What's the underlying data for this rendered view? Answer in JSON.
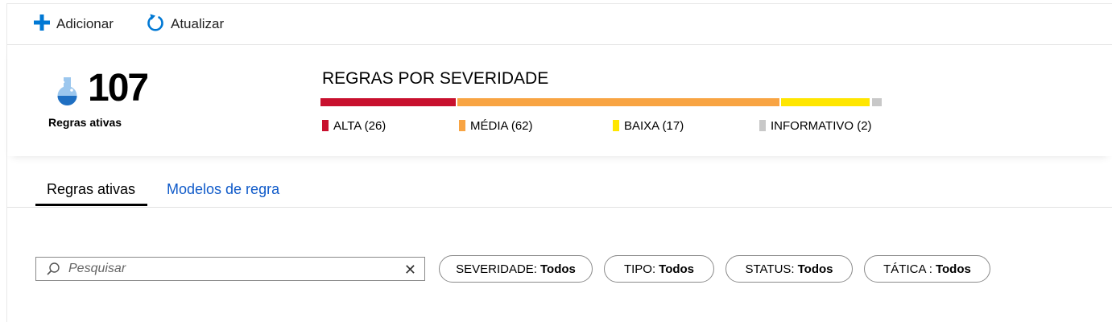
{
  "toolbar": {
    "add_label": "Adicionar",
    "refresh_label": "Atualizar"
  },
  "summary": {
    "active_count": "107",
    "active_label": "Regras ativas",
    "severity_title": "REGRAS POR SEVERIDADE",
    "severity": [
      {
        "key": "alta",
        "label": "ALTA (26)",
        "count": 26,
        "color": "#c8102e"
      },
      {
        "key": "media",
        "label": "MÉDIA (62)",
        "count": 62,
        "color": "#f8a443"
      },
      {
        "key": "baixa",
        "label": "BAIXA (17)",
        "count": 17,
        "color": "#ffe600"
      },
      {
        "key": "info",
        "label": "INFORMATIVO (2)",
        "count": 2,
        "color": "#c8c8c8"
      }
    ]
  },
  "tabs": {
    "active_rules": "Regras ativas",
    "rule_templates": "Modelos de regra"
  },
  "filters": {
    "search_placeholder": "Pesquisar",
    "clear_glyph": "✕",
    "pills": [
      {
        "key": "SEVERIDADE:",
        "value": "Todos"
      },
      {
        "key": "TIPO:",
        "value": "Todos"
      },
      {
        "key": "STATUS:",
        "value": "Todos"
      },
      {
        "key": "TÁTICA :",
        "value": "Todos"
      }
    ]
  },
  "colors": {
    "accent": "#0078d4",
    "link": "#0f5ac9"
  }
}
